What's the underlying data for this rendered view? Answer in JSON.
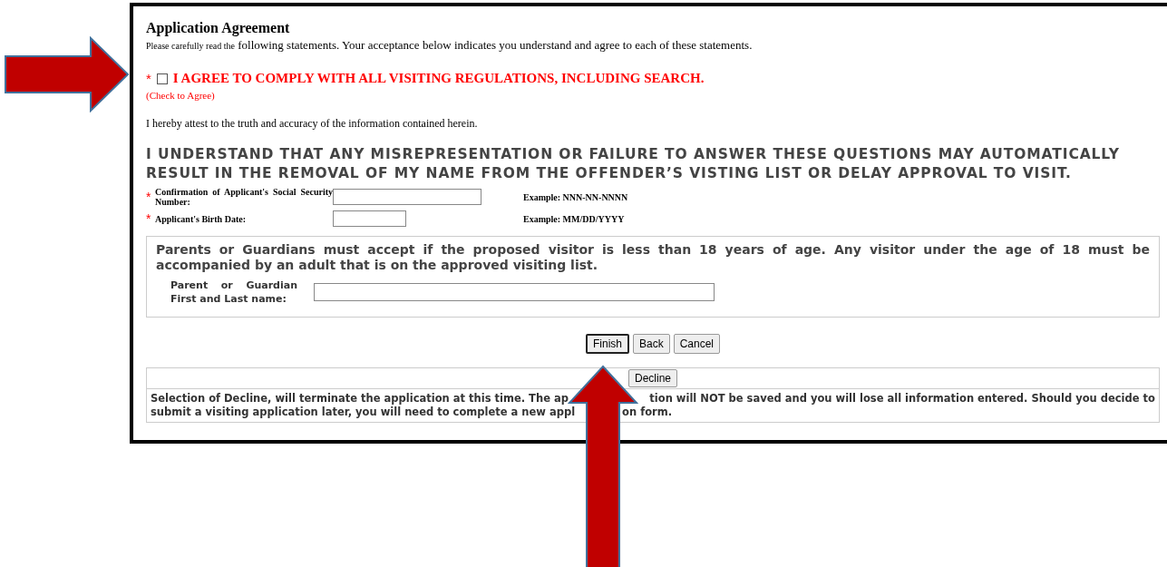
{
  "title": "Application Agreement",
  "intro": {
    "lead": "Please carefully read the",
    "rest": "following statements. Your acceptance below indicates you understand and agree to each of these statements."
  },
  "agreement": {
    "required_mark": "*",
    "checked": false,
    "label": "I AGREE TO COMPLY WITH ALL VISITING REGULATIONS, INCLUDING SEARCH.",
    "hint": "(Check to Agree)"
  },
  "attest": "I hereby attest to the truth and accuracy of the information contained herein.",
  "warning": "I UNDERSTAND THAT ANY MISREPRESENTATION OR FAILURE TO ANSWER THESE QUESTIONS MAY AUTOMATICALLY RESULT IN THE REMOVAL OF MY NAME FROM THE OFFENDER’S VISTING LIST OR DELAY APPROVAL TO VISIT.",
  "fields": [
    {
      "required_mark": "*",
      "label": "Confirmation of Applicant's Social Security Number:",
      "example": "Example: NNN-NN-NNNN"
    },
    {
      "required_mark": "*",
      "label": "Applicant's Birth Date:",
      "example": "Example: MM/DD/YYYY"
    }
  ],
  "guardian": {
    "notice": "Parents or Guardians must accept if the proposed visitor is less than 18 years of age. Any visitor under the age of 18 must be accompanied by an adult that is on the approved visiting list.",
    "label": "Parent or Guardian First and Last name:"
  },
  "buttons": [
    {
      "label": "Finish",
      "default": true
    },
    {
      "label": "Back",
      "default": false
    },
    {
      "label": "Cancel",
      "default": false
    }
  ],
  "decline": {
    "button": "Decline",
    "note_lines": [
      [
        "Selection of Decline, will terminate the application at this time. The ap",
        "tion will NOT be saved and you will lose all information entered. Should you decide to"
      ],
      [
        "submit a visiting application later, you will need to complete a new appl",
        "on form."
      ]
    ]
  }
}
